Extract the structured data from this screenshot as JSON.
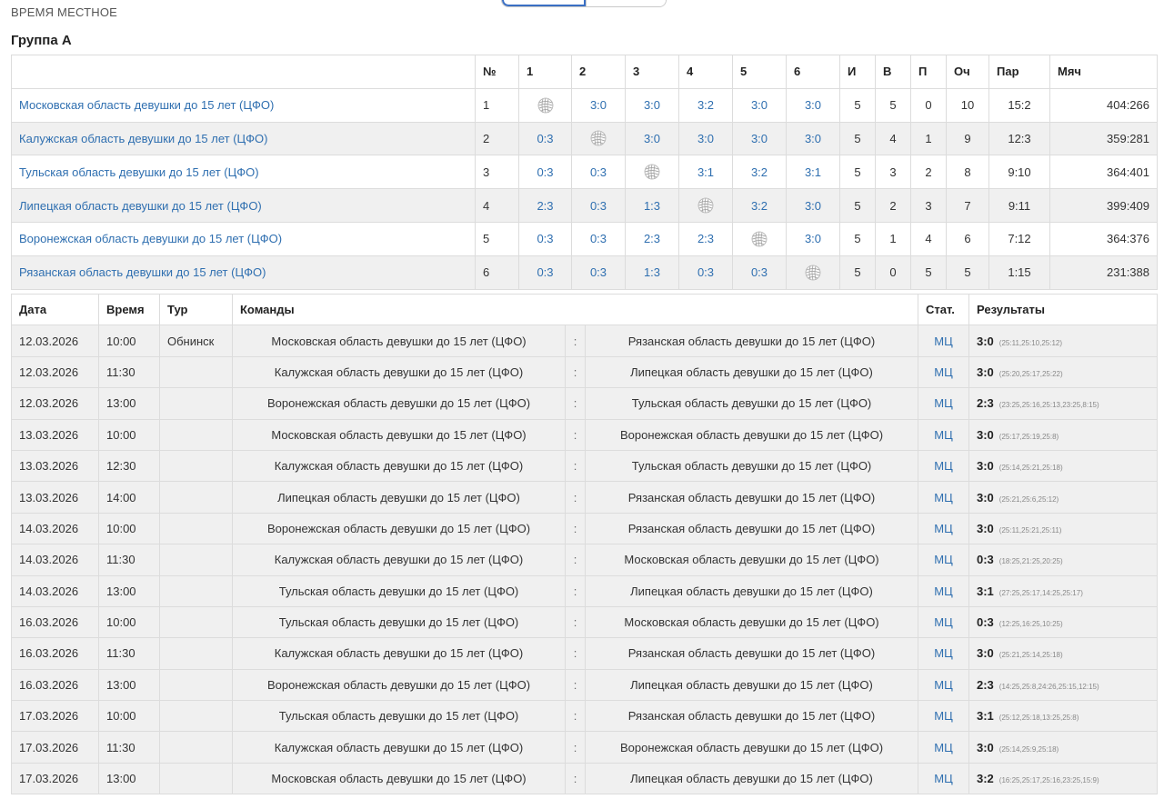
{
  "header": {
    "time_label": "ВРЕМЯ МЕСТНОЕ",
    "group_title": "Группа А"
  },
  "standings": {
    "columns": [
      "",
      "№",
      "1",
      "2",
      "3",
      "4",
      "5",
      "6",
      "И",
      "В",
      "П",
      "Оч",
      "Пар",
      "Мяч"
    ],
    "rows": [
      {
        "team": "Московская область девушки до 15 лет (ЦФО)",
        "num": "1",
        "results": [
          "",
          "3:0",
          "3:0",
          "3:2",
          "3:0",
          "3:0"
        ],
        "games": "5",
        "wins": "5",
        "losses": "0",
        "points": "10",
        "sets": "15:2",
        "balls": "404:266"
      },
      {
        "team": "Калужская область девушки до 15 лет (ЦФО)",
        "num": "2",
        "results": [
          "0:3",
          "",
          "3:0",
          "3:0",
          "3:0",
          "3:0"
        ],
        "games": "5",
        "wins": "4",
        "losses": "1",
        "points": "9",
        "sets": "12:3",
        "balls": "359:281"
      },
      {
        "team": "Тульская область девушки до 15 лет (ЦФО)",
        "num": "3",
        "results": [
          "0:3",
          "0:3",
          "",
          "3:1",
          "3:2",
          "3:1"
        ],
        "games": "5",
        "wins": "3",
        "losses": "2",
        "points": "8",
        "sets": "9:10",
        "balls": "364:401"
      },
      {
        "team": "Липецкая область девушки до 15 лет (ЦФО)",
        "num": "4",
        "results": [
          "2:3",
          "0:3",
          "1:3",
          "",
          "3:2",
          "3:0"
        ],
        "games": "5",
        "wins": "2",
        "losses": "3",
        "points": "7",
        "sets": "9:11",
        "balls": "399:409"
      },
      {
        "team": "Воронежская область девушки до 15 лет (ЦФО)",
        "num": "5",
        "results": [
          "0:3",
          "0:3",
          "2:3",
          "2:3",
          "",
          "3:0"
        ],
        "games": "5",
        "wins": "1",
        "losses": "4",
        "points": "6",
        "sets": "7:12",
        "balls": "364:376"
      },
      {
        "team": "Рязанская область девушки до 15 лет (ЦФО)",
        "num": "6",
        "results": [
          "0:3",
          "0:3",
          "1:3",
          "0:3",
          "0:3",
          ""
        ],
        "games": "5",
        "wins": "0",
        "losses": "5",
        "points": "5",
        "sets": "1:15",
        "balls": "231:388"
      }
    ]
  },
  "schedule": {
    "columns": {
      "date": "Дата",
      "time": "Время",
      "tour": "Тур",
      "teams": "Команды",
      "stat": "Стат.",
      "results": "Результаты"
    },
    "separator": ":",
    "matches": [
      {
        "date": "12.03.2026",
        "time": "10:00",
        "tour": "Обнинск",
        "home": "Московская область девушки до 15 лет (ЦФО)",
        "away": "Рязанская область девушки до 15 лет (ЦФО)",
        "stat": "МЦ",
        "score": "3:0",
        "sets": "(25:11,25:10,25:12)"
      },
      {
        "date": "12.03.2026",
        "time": "11:30",
        "tour": "",
        "home": "Калужская область девушки до 15 лет (ЦФО)",
        "away": "Липецкая область девушки до 15 лет (ЦФО)",
        "stat": "МЦ",
        "score": "3:0",
        "sets": "(25:20,25:17,25:22)"
      },
      {
        "date": "12.03.2026",
        "time": "13:00",
        "tour": "",
        "home": "Воронежская область девушки до 15 лет (ЦФО)",
        "away": "Тульская область девушки до 15 лет (ЦФО)",
        "stat": "МЦ",
        "score": "2:3",
        "sets": "(23:25,25:16,25:13,23:25,8:15)"
      },
      {
        "date": "13.03.2026",
        "time": "10:00",
        "tour": "",
        "home": "Московская область девушки до 15 лет (ЦФО)",
        "away": "Воронежская область девушки до 15 лет (ЦФО)",
        "stat": "МЦ",
        "score": "3:0",
        "sets": "(25:17,25:19,25:8)"
      },
      {
        "date": "13.03.2026",
        "time": "12:30",
        "tour": "",
        "home": "Калужская область девушки до 15 лет (ЦФО)",
        "away": "Тульская область девушки до 15 лет (ЦФО)",
        "stat": "МЦ",
        "score": "3:0",
        "sets": "(25:14,25:21,25:18)"
      },
      {
        "date": "13.03.2026",
        "time": "14:00",
        "tour": "",
        "home": "Липецкая область девушки до 15 лет (ЦФО)",
        "away": "Рязанская область девушки до 15 лет (ЦФО)",
        "stat": "МЦ",
        "score": "3:0",
        "sets": "(25:21,25:6,25:12)"
      },
      {
        "date": "14.03.2026",
        "time": "10:00",
        "tour": "",
        "home": "Воронежская область девушки до 15 лет (ЦФО)",
        "away": "Рязанская область девушки до 15 лет (ЦФО)",
        "stat": "МЦ",
        "score": "3:0",
        "sets": "(25:11,25:21,25:11)"
      },
      {
        "date": "14.03.2026",
        "time": "11:30",
        "tour": "",
        "home": "Калужская область девушки до 15 лет (ЦФО)",
        "away": "Московская область девушки до 15 лет (ЦФО)",
        "stat": "МЦ",
        "score": "0:3",
        "sets": "(18:25,21:25,20:25)"
      },
      {
        "date": "14.03.2026",
        "time": "13:00",
        "tour": "",
        "home": "Тульская область девушки до 15 лет (ЦФО)",
        "away": "Липецкая область девушки до 15 лет (ЦФО)",
        "stat": "МЦ",
        "score": "3:1",
        "sets": "(27:25,25:17,14:25,25:17)"
      },
      {
        "date": "16.03.2026",
        "time": "10:00",
        "tour": "",
        "home": "Тульская область девушки до 15 лет (ЦФО)",
        "away": "Московская область девушки до 15 лет (ЦФО)",
        "stat": "МЦ",
        "score": "0:3",
        "sets": "(12:25,16:25,10:25)"
      },
      {
        "date": "16.03.2026",
        "time": "11:30",
        "tour": "",
        "home": "Калужская область девушки до 15 лет (ЦФО)",
        "away": "Рязанская область девушки до 15 лет (ЦФО)",
        "stat": "МЦ",
        "score": "3:0",
        "sets": "(25:21,25:14,25:18)"
      },
      {
        "date": "16.03.2026",
        "time": "13:00",
        "tour": "",
        "home": "Воронежская область девушки до 15 лет (ЦФО)",
        "away": "Липецкая область девушки до 15 лет (ЦФО)",
        "stat": "МЦ",
        "score": "2:3",
        "sets": "(14:25,25:8,24:26,25:15,12:15)"
      },
      {
        "date": "17.03.2026",
        "time": "10:00",
        "tour": "",
        "home": "Тульская область девушки до 15 лет (ЦФО)",
        "away": "Рязанская область девушки до 15 лет (ЦФО)",
        "stat": "МЦ",
        "score": "3:1",
        "sets": "(25:12,25:18,13:25,25:8)"
      },
      {
        "date": "17.03.2026",
        "time": "11:30",
        "tour": "",
        "home": "Калужская область девушки до 15 лет (ЦФО)",
        "away": "Воронежская область девушки до 15 лет (ЦФО)",
        "stat": "МЦ",
        "score": "3:0",
        "sets": "(25:14,25:9,25:18)"
      },
      {
        "date": "17.03.2026",
        "time": "13:00",
        "tour": "",
        "home": "Московская область девушки до 15 лет (ЦФО)",
        "away": "Липецкая область девушки до 15 лет (ЦФО)",
        "stat": "МЦ",
        "score": "3:2",
        "sets": "(16:25,25:17,25:16,23:25,15:9)"
      }
    ]
  },
  "colors": {
    "link": "#2f6fb0",
    "row_alt": "#f0f0f0",
    "border": "#dcdcdc",
    "toggle_active": "#3a6fc4"
  },
  "icons": {
    "diagonal_cell": "volleyball-icon"
  }
}
